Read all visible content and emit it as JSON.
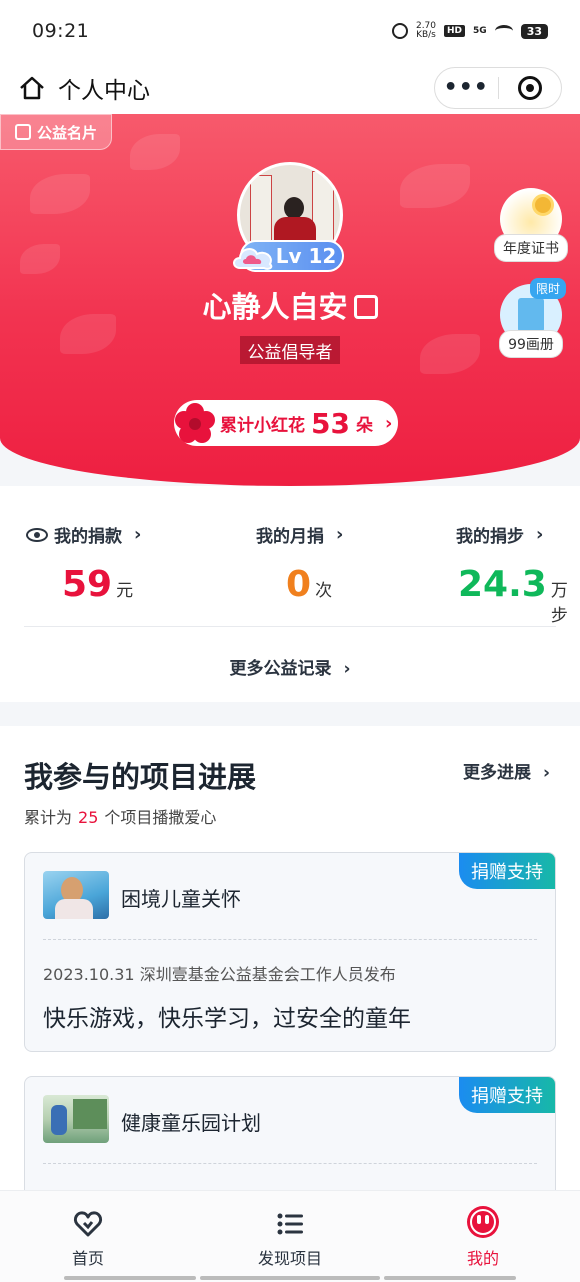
{
  "status_bar": {
    "time": "09:21",
    "net_speed": "2.70",
    "net_unit": "KB/s",
    "hd": "HD",
    "signal": "5G",
    "battery": "33"
  },
  "nav": {
    "title": "个人中心",
    "more": "•••"
  },
  "hero": {
    "card_tag": "公益名片",
    "level": "Lv 12",
    "nickname": "心静人自安",
    "role": "公益倡导者",
    "flowers_prefix": "累计小红花",
    "flowers_count": "53",
    "flowers_unit": "朵",
    "cert_label": "年度证书",
    "album_label": "99画册",
    "album_badge": "限时"
  },
  "stats": {
    "donation": {
      "label": "我的捐款",
      "value": "59",
      "unit": "元"
    },
    "monthly": {
      "label": "我的月捐",
      "value": "0",
      "unit": "次"
    },
    "steps": {
      "label": "我的捐步",
      "value": "24.3",
      "unit": "万步"
    },
    "more_records": "更多公益记录"
  },
  "projects": {
    "title": "我参与的项目进展",
    "more": "更多进展",
    "sub_prefix": "累计为",
    "count": "25",
    "sub_suffix": "个项目播撒爱心",
    "items": [
      {
        "name": "困境儿童关怀",
        "donate": "捐赠支持",
        "meta": "2023.10.31 深圳壹基金公益基金会工作人员发布",
        "desc": "快乐游戏，快乐学习，过安全的童年"
      },
      {
        "name": "健康童乐园计划",
        "donate": "捐赠支持"
      }
    ]
  },
  "tabbar": {
    "home": "首页",
    "discover": "发现项目",
    "mine": "我的"
  },
  "colors": {
    "brand_red": "#e8123c",
    "green": "#0fb85a",
    "orange": "#f0801e"
  }
}
